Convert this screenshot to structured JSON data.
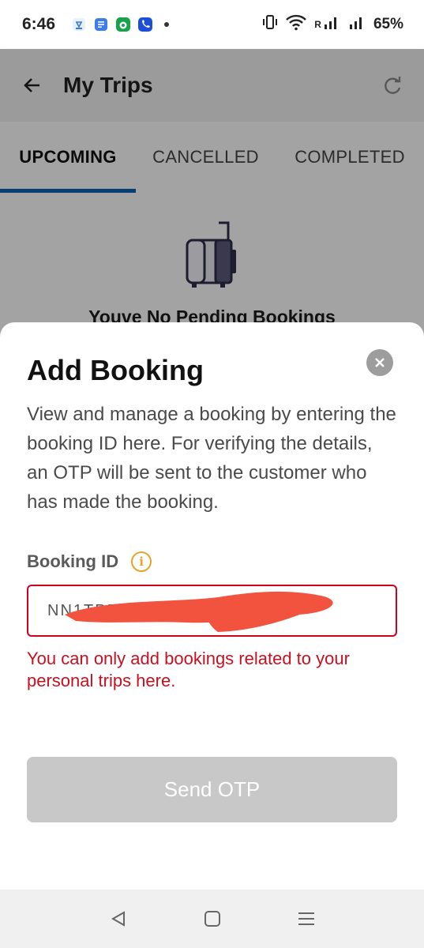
{
  "status_bar": {
    "time": "6:46",
    "battery": "65%",
    "signal_label": "R",
    "notification_icons": [
      "weather-icon",
      "docs-icon",
      "app-icon",
      "phone-icon"
    ]
  },
  "header": {
    "title": "My Trips"
  },
  "tabs": [
    {
      "label": "UPCOMING",
      "selected": true
    },
    {
      "label": "CANCELLED",
      "selected": false
    },
    {
      "label": "COMPLETED",
      "selected": false
    }
  ],
  "empty_state": {
    "text": "Youve No Pending Bookings"
  },
  "sheet": {
    "title": "Add Booking",
    "description": "View and manage a booking by entering the booking ID here. For verifying the details, an OTP will be sent to the customer who has made the booking.",
    "field_label": "Booking ID",
    "input_value": "NN1TPP•••••••",
    "error": "You can only add bookings related to your personal trips here.",
    "button_label": "Send OTP"
  },
  "colors": {
    "accent_tab": "#0b61b5",
    "error": "#c8101f",
    "info": "#e6a526",
    "disabled_button": "#c8c8c8"
  }
}
